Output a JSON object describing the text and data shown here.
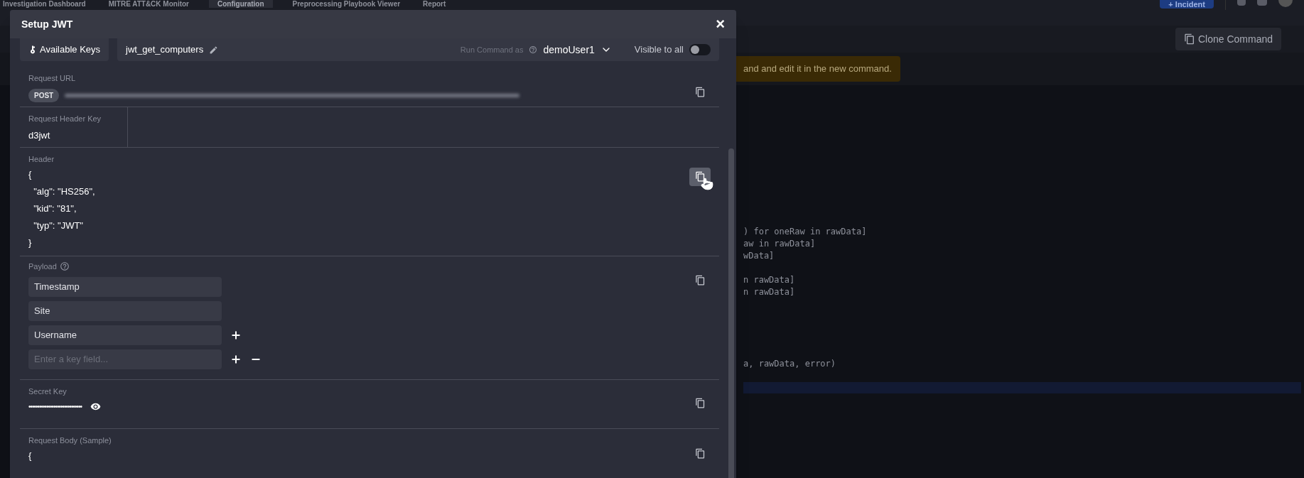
{
  "nav_tabs": [
    {
      "label": "Investigation Dashboard",
      "selected": false
    },
    {
      "label": "MITRE ATT&CK Monitor",
      "selected": false
    },
    {
      "label": "Configuration",
      "selected": true
    },
    {
      "label": "Preprocessing Playbook Viewer",
      "selected": false
    },
    {
      "label": "Report",
      "selected": false
    }
  ],
  "incident_button": "+ Incident",
  "clone_button": "Clone Command",
  "banner": "and and edit it in the new command.",
  "code_blocks": [
    [
      ") for oneRaw in rawData]",
      "aw in rawData]",
      "wData]"
    ],
    [
      "n rawData]",
      "n rawData]"
    ],
    [
      "a, rawData, error)"
    ]
  ],
  "modal": {
    "title": "Setup JWT",
    "close": "×",
    "available_keys": "Available Keys",
    "command_name": "jwt_get_computers",
    "run_as_label": "Run Command as",
    "run_as_user": "demoUser1",
    "visible_label": "Visible to all",
    "visible_on": false,
    "request_url": {
      "label": "Request URL",
      "method": "POST",
      "copy_highlighted": false
    },
    "header_key": {
      "label": "Request Header Key",
      "value": "d3jwt"
    },
    "header": {
      "label": "Header",
      "lines": [
        "{",
        "  \"alg\": \"HS256\",",
        "  \"kid\": \"81\",",
        "  \"typ\": \"JWT\"",
        "}"
      ],
      "copy_highlighted": true
    },
    "payload": {
      "label": "Payload",
      "fields": [
        {
          "value": "Timestamp",
          "add": false,
          "remove": false
        },
        {
          "value": "Site",
          "add": false,
          "remove": false
        },
        {
          "value": "Username",
          "add": true,
          "remove": false
        },
        {
          "placeholder": "Enter a key field...",
          "add": true,
          "remove": true
        }
      ],
      "copy_highlighted": false
    },
    "secret": {
      "label": "Secret Key",
      "value": "••••••••••••••••••••••••••••••",
      "copy_highlighted": false
    },
    "body": {
      "label": "Request Body (Sample)",
      "lines": [
        "{"
      ],
      "copy_highlighted": false
    }
  }
}
